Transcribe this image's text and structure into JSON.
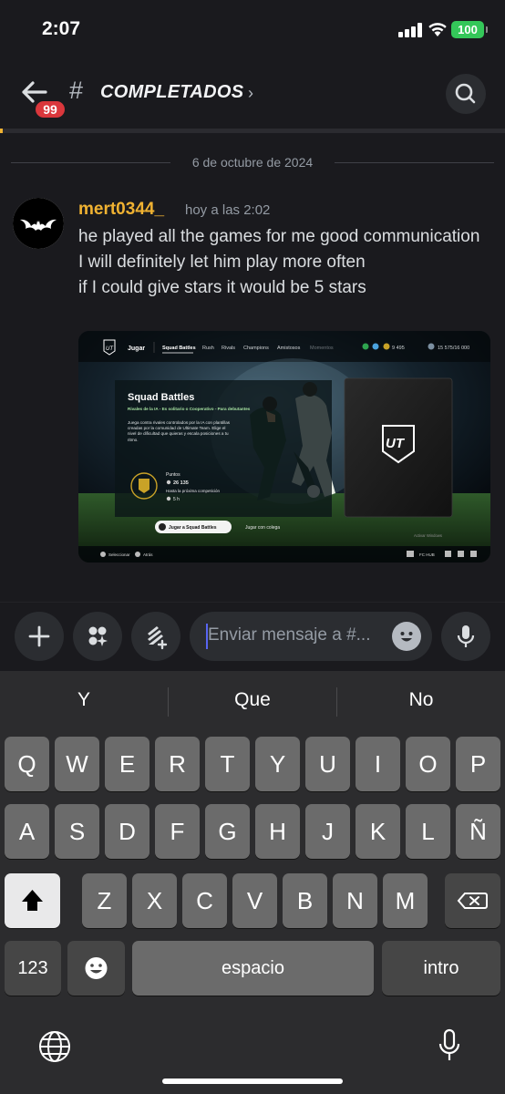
{
  "status_bar": {
    "time": "2:07",
    "battery": "100"
  },
  "header": {
    "badge_count": "99",
    "hash_symbol": "#",
    "channel_name": "COMPLETADOS",
    "chevron": "›"
  },
  "date_divider": "6 de octubre de 2024",
  "message": {
    "username": "mert0344_",
    "timestamp": "hoy a las 2:02",
    "lines": [
      "he played all the games for me good communication I will definitely let him play more often",
      "if I could give stars it would be 5 stars"
    ]
  },
  "attachment": {
    "nav_play": "Jugar",
    "tabs": [
      "Squad Battles",
      "Rush",
      "Rivals",
      "Champions",
      "Amistosos",
      "Momentos"
    ],
    "coins": "9 495",
    "points": "15 575/16 000",
    "panel_title": "Squad Battles",
    "panel_subtitle": "Rivales de la IA - Es solitario o Cooperativo - Para debutantes",
    "panel_desc": "Juega contra rivales controlados por la IA con plantillas creadas por la comunidad de Ultimate Team. Elige el nivel de dificultad que quieras y escala posiciones a tu ritmo.",
    "rank_label": "Puntos",
    "rank_points": "26 135",
    "next_label": "Hasta la próxima competición",
    "next_time": "5 h",
    "btn_primary": "Jugar a Squad Battles",
    "btn_secondary": "Jugar con colega",
    "footer_select": "Seleccionar",
    "footer_back": "Atrás",
    "ut_logo": "UT",
    "activate_windows": "Activar Windows",
    "fc_hub": "FC HUB"
  },
  "composer": {
    "placeholder": "Enviar mensaje a #..."
  },
  "keyboard": {
    "suggestions": [
      "Y",
      "Que",
      "No"
    ],
    "row1": [
      "Q",
      "W",
      "E",
      "R",
      "T",
      "Y",
      "U",
      "I",
      "O",
      "P"
    ],
    "row2": [
      "A",
      "S",
      "D",
      "F",
      "G",
      "H",
      "J",
      "K",
      "L",
      "Ñ"
    ],
    "row3": [
      "Z",
      "X",
      "C",
      "V",
      "B",
      "N",
      "M"
    ],
    "numbers_key": "123",
    "space_key": "espacio",
    "return_key": "intro"
  }
}
